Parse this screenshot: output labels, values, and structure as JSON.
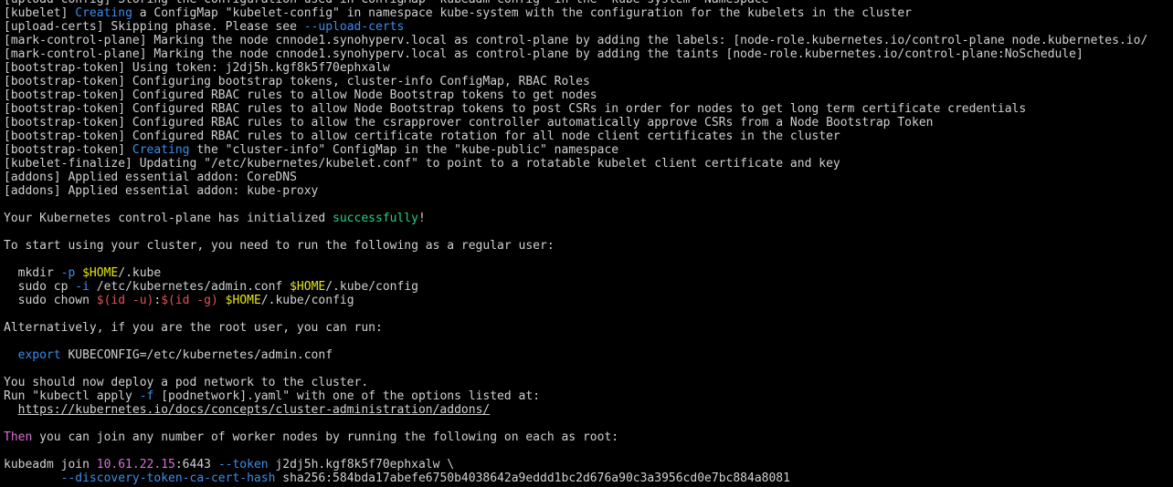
{
  "terminal": {
    "colors": {
      "background": "#000000",
      "default": "#d0d0d0",
      "blue": "#3b8eea",
      "green": "#23d18b",
      "magenta": "#d670d6",
      "red": "#e05252",
      "yellow": "#e5e510"
    },
    "lines": [
      [
        {
          "t": "[upload-config] Storing the configuration used in ConfigMap \"kubeadm-config\" in the \"kube-system\" Namespace"
        }
      ],
      [
        {
          "t": "[kubelet] "
        },
        {
          "t": "Creating",
          "c": "blue"
        },
        {
          "t": " a ConfigMap \"kubelet-config\" in namespace kube-system with the configuration for the kubelets in the cluster"
        }
      ],
      [
        {
          "t": "[upload-certs] Skipping phase. Please see "
        },
        {
          "t": "--upload-certs",
          "c": "blue"
        }
      ],
      [
        {
          "t": "[mark-control-plane] Marking the node cnnode1.synohyperv.local as control-plane by adding the labels: [node-role.kubernetes.io/control-plane node.kubernetes.io/"
        }
      ],
      [
        {
          "t": "[mark-control-plane] Marking the node cnnode1.synohyperv.local as control-plane by adding the taints [node-role.kubernetes.io/control-plane:NoSchedule]"
        }
      ],
      [
        {
          "t": "[bootstrap-token] Using token: j2dj5h.kgf8k5f70ephxalw"
        }
      ],
      [
        {
          "t": "[bootstrap-token] Configuring bootstrap tokens, cluster-info ConfigMap, RBAC Roles"
        }
      ],
      [
        {
          "t": "[bootstrap-token] Configured RBAC rules to allow Node Bootstrap tokens to get nodes"
        }
      ],
      [
        {
          "t": "[bootstrap-token] Configured RBAC rules to allow Node Bootstrap tokens to post CSRs in order for nodes to get long term certificate credentials"
        }
      ],
      [
        {
          "t": "[bootstrap-token] Configured RBAC rules to allow the csrapprover controller automatically approve CSRs from a Node Bootstrap Token"
        }
      ],
      [
        {
          "t": "[bootstrap-token] Configured RBAC rules to allow certificate rotation for all node client certificates in the cluster"
        }
      ],
      [
        {
          "t": "[bootstrap-token] "
        },
        {
          "t": "Creating",
          "c": "blue"
        },
        {
          "t": " the \"cluster-info\" ConfigMap in the \"kube-public\" namespace"
        }
      ],
      [
        {
          "t": "[kubelet-finalize] Updating \"/etc/kubernetes/kubelet.conf\" to point to a rotatable kubelet client certificate and key"
        }
      ],
      [
        {
          "t": "[addons] Applied essential addon: CoreDNS"
        }
      ],
      [
        {
          "t": "[addons] Applied essential addon: kube-proxy"
        }
      ],
      [],
      [
        {
          "t": "Your Kubernetes control-plane has initialized "
        },
        {
          "t": "successfully",
          "c": "green"
        },
        {
          "t": "!"
        }
      ],
      [],
      [
        {
          "t": "To start using your cluster, you need to run the following as a regular user:"
        }
      ],
      [],
      [
        {
          "t": "  mkdir "
        },
        {
          "t": "-p",
          "c": "blue"
        },
        {
          "t": " "
        },
        {
          "t": "$HOME",
          "c": "yellow"
        },
        {
          "t": "/.kube"
        }
      ],
      [
        {
          "t": "  sudo cp "
        },
        {
          "t": "-i",
          "c": "blue"
        },
        {
          "t": " /etc/kubernetes/admin.conf "
        },
        {
          "t": "$HOME",
          "c": "yellow"
        },
        {
          "t": "/.kube/config"
        }
      ],
      [
        {
          "t": "  sudo chown "
        },
        {
          "t": "$(id -u)",
          "c": "red"
        },
        {
          "t": ":"
        },
        {
          "t": "$(id -g)",
          "c": "red"
        },
        {
          "t": " "
        },
        {
          "t": "$HOME",
          "c": "yellow"
        },
        {
          "t": "/.kube/config"
        }
      ],
      [],
      [
        {
          "t": "Alternatively, if you are the root user, you can run:"
        }
      ],
      [],
      [
        {
          "t": "  "
        },
        {
          "t": "export",
          "c": "blue"
        },
        {
          "t": " KUBECONFIG=/etc/kubernetes/admin.conf"
        }
      ],
      [],
      [
        {
          "t": "You should now deploy a pod network to the cluster."
        }
      ],
      [
        {
          "t": "Run \"kubectl apply "
        },
        {
          "t": "-f",
          "c": "blue"
        },
        {
          "t": " [podnetwork].yaml\" with one of the options listed at:"
        }
      ],
      [
        {
          "t": "  "
        },
        {
          "t": "https://kubernetes.io/docs/concepts/cluster-administration/addons/",
          "u": true
        }
      ],
      [],
      [
        {
          "t": "Then",
          "c": "magenta"
        },
        {
          "t": " you can join any number of worker nodes by running the following on each as root:"
        }
      ],
      [],
      [
        {
          "t": "kubeadm join "
        },
        {
          "t": "10.61.22.15",
          "c": "magenta"
        },
        {
          "t": ":6443 "
        },
        {
          "t": "--token",
          "c": "blue"
        },
        {
          "t": " j2dj5h.kgf8k5f70ephxalw \\"
        }
      ],
      [
        {
          "t": "        "
        },
        {
          "t": "--discovery-token-ca-cert-hash",
          "c": "blue"
        },
        {
          "t": " sha256:584bda17abefe6750b4038642a9eddd1bc2d676a90c3a3956cd0e7bc884a8081"
        }
      ]
    ]
  }
}
